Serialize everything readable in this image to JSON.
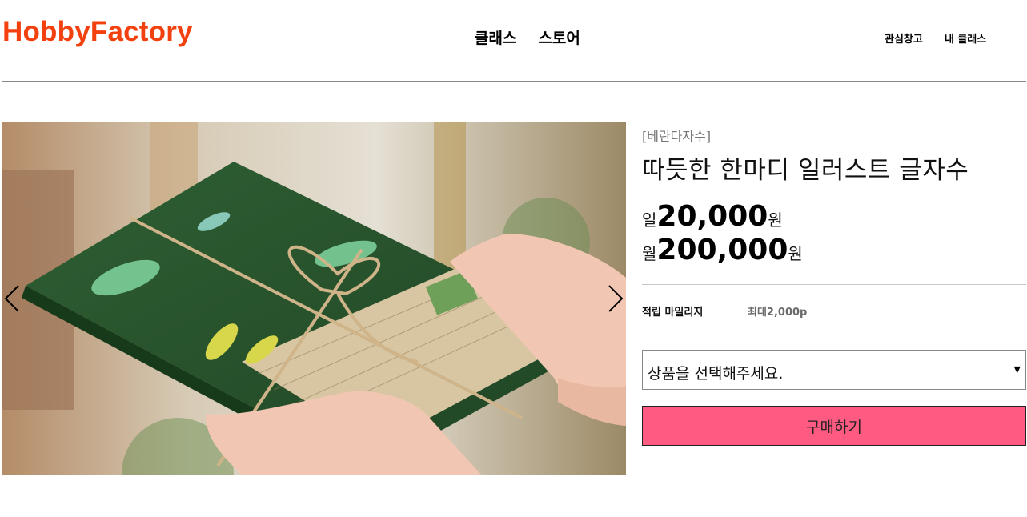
{
  "header": {
    "logo": "HobbyFactory",
    "main_nav": [
      {
        "label": "클래스"
      },
      {
        "label": "스토어"
      }
    ],
    "util_nav": [
      {
        "label": "관심창고"
      },
      {
        "label": "내 클래스"
      }
    ]
  },
  "gallery": {
    "prev_icon": "chevron-left-icon",
    "next_icon": "chevron-right-icon",
    "colors": {
      "book": "#2e5a30",
      "hand": "#f1c7b3",
      "paper": "#d9c7a5"
    }
  },
  "product": {
    "brand": "[베란다자수]",
    "title": "따듯한 한마디 일러스트 글자수",
    "prices": [
      {
        "unit": "일",
        "value": "20,000",
        "currency": "원"
      },
      {
        "unit": "월",
        "value": "200,000",
        "currency": "원"
      }
    ],
    "mileage": {
      "label": "적립 마일리지",
      "value": "최대2,000p"
    },
    "option_select": {
      "placeholder": "상품을 선택해주세요.",
      "caret": "▼"
    },
    "buy_label": "구매하기"
  },
  "colors": {
    "logo": "#f2410f",
    "buy_button": "#ff5a82"
  }
}
